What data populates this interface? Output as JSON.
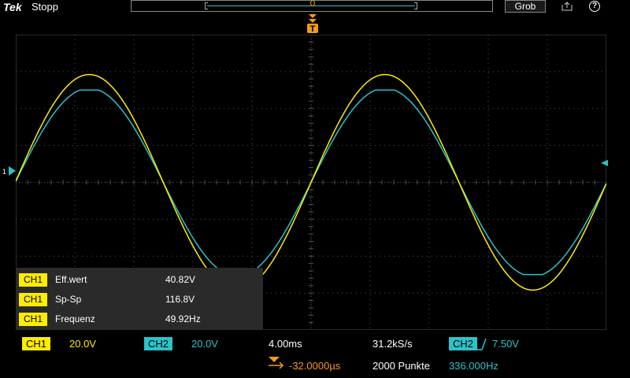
{
  "header": {
    "brand": "Tek",
    "acquisition_status": "Stopp",
    "zoom_button": "Grob",
    "trigger_marker": "T"
  },
  "waveforms": {
    "ch1": {
      "color": "#ffec00",
      "amplitude_v": 58.4,
      "frequency_hz": 49.92
    },
    "ch2": {
      "color": "#2bc3c9",
      "amplitude_v": 51.0,
      "frequency_hz": 49.92
    }
  },
  "channel_marker": "1",
  "measurements": [
    {
      "channel": "CH1",
      "name": "Eff.wert",
      "value": "40.82V"
    },
    {
      "channel": "CH1",
      "name": "Sp-Sp",
      "value": "116.8V"
    },
    {
      "channel": "CH1",
      "name": "Frequenz",
      "value": "49.92Hz"
    }
  ],
  "bottom_bar": {
    "ch1_label": "CH1",
    "ch1_scale": "20.0V",
    "ch2_label": "CH2",
    "ch2_scale": "20.0V",
    "timebase": "4.00ms",
    "sample_rate": "31.2kS/s",
    "trigger_source": "CH2",
    "trigger_level": "7.50V",
    "trigger_position": "-32.0000µs",
    "record_length": "2000 Punkte",
    "trigger_frequency": "336.000Hz"
  },
  "colors": {
    "ch1": "#ffec00",
    "ch2": "#2bc3c9",
    "trigger": "#f29b1c",
    "grid": "#555555"
  }
}
